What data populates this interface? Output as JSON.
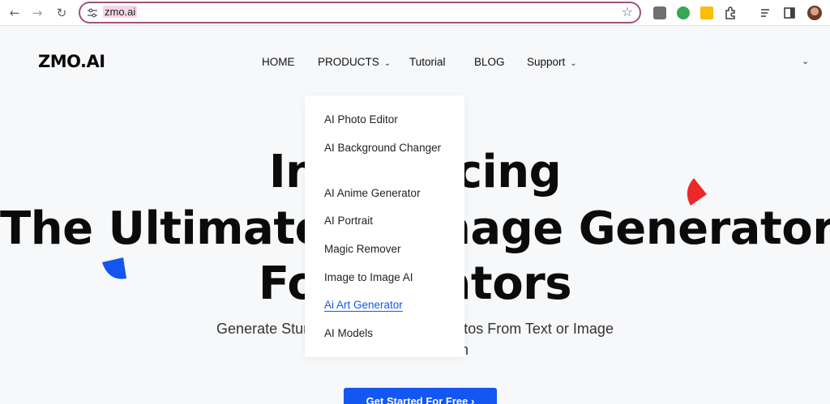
{
  "browser": {
    "url": "zmo.ai",
    "icons": [
      "back-icon",
      "forward-icon",
      "reload-icon",
      "site-settings-icon",
      "bookmark-star-icon",
      "extensions-icon",
      "reading-list-icon",
      "side-panel-icon",
      "profile-avatar"
    ]
  },
  "header": {
    "logo": "ZMO.AI",
    "nav": {
      "home": "HOME",
      "products": "PRODUCTS",
      "tutorial": "Tutorial",
      "blog": "BLOG",
      "support": "Support"
    }
  },
  "hero": {
    "line1": "Introducing",
    "line2": "The Ultimate AI Image Generator",
    "line3": "For Creators",
    "subtitle_line1": "Generate Stunning Art & Realistic Photos From Text or Image",
    "subtitle_line2": "With One Button",
    "cta": "Get Started For Free"
  },
  "dropdown": {
    "items": [
      "AI Photo Editor",
      "AI Background Changer",
      "AI Anime Generator",
      "AI Portrait",
      "Magic Remover",
      "Image to Image AI",
      "Ai Art Generator",
      "AI Models"
    ],
    "active_index": 6
  },
  "colors": {
    "accent": "#1456f0",
    "deco_red": "#ea2a2a",
    "deco_blue": "#1456f0",
    "omnibox_border": "#9e5378"
  }
}
